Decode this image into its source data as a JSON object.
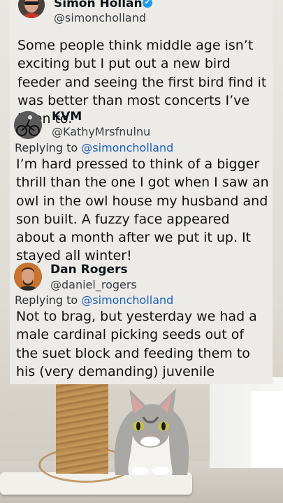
{
  "tweets": [
    {
      "name": "Simon Holland",
      "handle": "@simoncholland",
      "verified": true,
      "text": "Some people think middle age isn’t exciting but I put out a new bird feeder and seeing the first bird find it was better than most concerts I’ve been to."
    },
    {
      "name": "KVM",
      "handle": "@KathyMrsfnulnu",
      "reply_prefix": "Replying to",
      "reply_mention": "@simoncholland",
      "text": "I’m hard pressed to think of a bigger thrill than the one I got when I saw an owl in the owl house my husband and son built. A fuzzy face appeared about a month after we put it up. It stayed all winter!"
    },
    {
      "name": "Dan Rogers",
      "handle": "@daniel_rogers",
      "reply_prefix": "Replying to",
      "reply_mention": "@simoncholland",
      "text": "Not to brag, but yesterday we had a male cardinal picking seeds out of the suet block and feeding them to his (very demanding) juvenile offspring."
    }
  ],
  "colors": {
    "card_bg": "#ecebe8",
    "mention": "#1d5fb8",
    "verified": "#1d9bf0"
  }
}
